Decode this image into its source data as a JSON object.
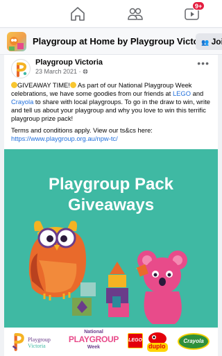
{
  "nav": {
    "notifications_badge": "9+"
  },
  "group": {
    "title": "Playgroup at Home by Playgroup Victoria",
    "join_label": "Joi"
  },
  "post": {
    "author": "Playgroup Victoria",
    "date": "23 March 2021",
    "visibility_icon": "globe-icon",
    "text_1a": "GIVEAWAY TIME!",
    "text_1b": " As part of our National Playgroup Week celebrations, we have some goodies from our friends at ",
    "lego_link": "LEGO",
    "text_1c": " and ",
    "crayola_link": "Crayola",
    "text_1d": " to share with local playgroups. To go in the draw to win, write and tell us about your playgroup and why you love to win this terrific playgroup prize pack!",
    "terms": "Terms and conditions apply. View our ts&cs here:",
    "terms_url": "https://www.playgroup.org.au/npw-tc/"
  },
  "promo": {
    "title_line1": "Playgroup Pack",
    "title_line2": "Giveaways",
    "bg_color": "#3fb9a3"
  },
  "logos": {
    "playgroup_vic_1": "Playgroup",
    "playgroup_vic_2": "Victoria",
    "npw_top": "National",
    "npw_mid": "PLAYGROUP",
    "npw_bot": "Week",
    "lego": "LEGO",
    "duplo": "duplo",
    "crayola": "Crayola"
  }
}
